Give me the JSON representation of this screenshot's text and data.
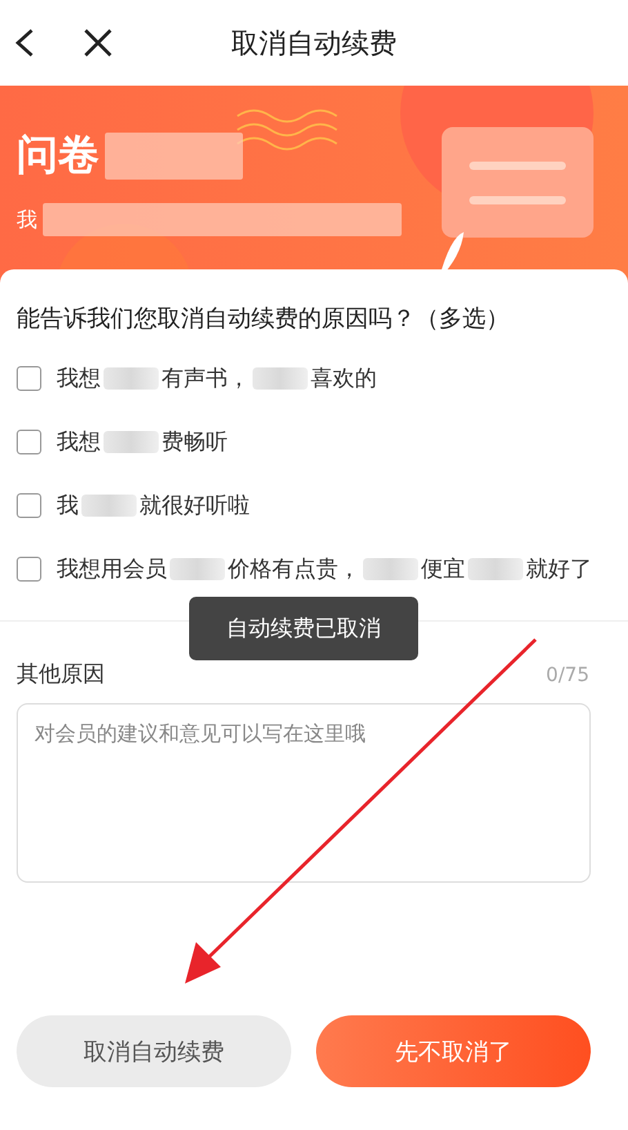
{
  "top_bar": {
    "title": "取消自动续费"
  },
  "banner": {
    "title": "问卷",
    "subtitle": "我"
  },
  "question": "能告诉我们您取消自动续费的原因吗？（多选）",
  "options": [
    {
      "parts": [
        "我想",
        "有声书，",
        "喜欢的"
      ],
      "checked": false
    },
    {
      "parts": [
        "我想",
        "费畅听"
      ],
      "checked": false
    },
    {
      "parts": [
        "我",
        "就很好听啦"
      ],
      "checked": false
    },
    {
      "parts": [
        "我想用会员",
        "价格有点贵，",
        "便宜",
        "就好了"
      ],
      "checked": false
    }
  ],
  "toast": "自动续费已取消",
  "other_reason": {
    "label": "其他原因",
    "counter": "0/75",
    "placeholder": "对会员的建议和意见可以写在这里哦"
  },
  "buttons": [
    {
      "label": "取消自动续费",
      "kind": "secondary"
    },
    {
      "label": "先不取消了",
      "kind": "primary"
    }
  ]
}
